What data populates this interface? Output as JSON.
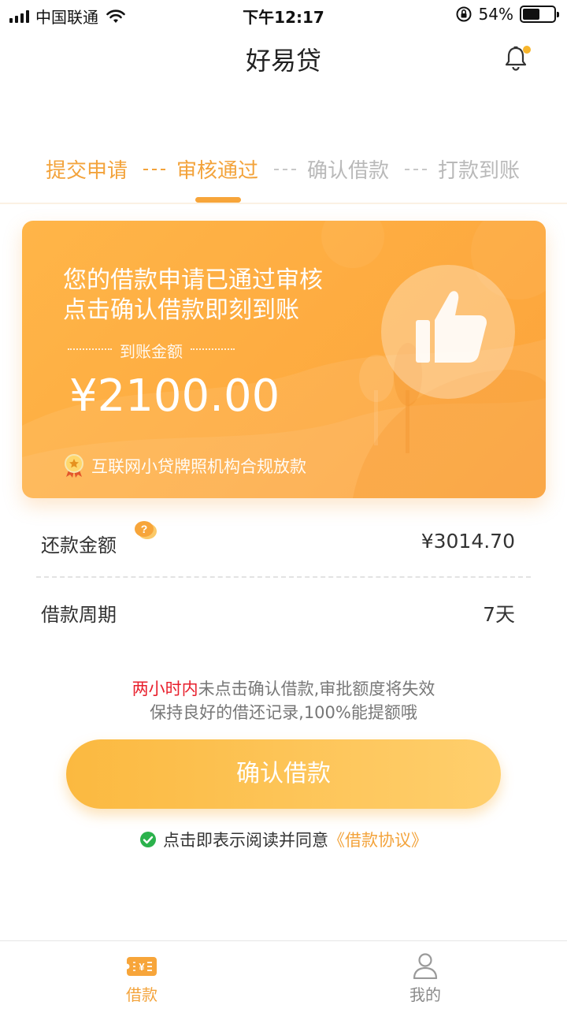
{
  "status_bar": {
    "carrier": "中国联通",
    "time": "下午12:17",
    "battery": "54%",
    "battery_level": 0.54
  },
  "header": {
    "title": "好易贷"
  },
  "steps": [
    {
      "label": "提交申请",
      "state": "done"
    },
    {
      "label": "审核通过",
      "state": "current"
    },
    {
      "label": "确认借款",
      "state": "todo"
    },
    {
      "label": "打款到账",
      "state": "todo"
    }
  ],
  "card": {
    "line1": "您的借款申请已通过审核",
    "line2": "点击确认借款即刻到账",
    "amount_label": "到账金额",
    "amount": "¥2100.00",
    "license_text": "互联网小贷牌照机构合规放款"
  },
  "rows": {
    "repay_label": "还款金额",
    "repay_value": "¥3014.70",
    "period_label": "借款周期",
    "period_value": "7天"
  },
  "notes": {
    "warn_highlight": "两小时内",
    "warn_rest": "未点击确认借款,审批额度将失效",
    "tip": "保持良好的借还记录,100%能提额哦"
  },
  "confirm_button": "确认借款",
  "agreement": {
    "prefix": "点击即表示阅读并同意",
    "link": "《借款协议》"
  },
  "tabbar": {
    "loan": "借款",
    "mine": "我的"
  },
  "colors": {
    "accent": "#f3a33b",
    "warning": "#e8202d",
    "inactive": "#b9b9b9"
  }
}
